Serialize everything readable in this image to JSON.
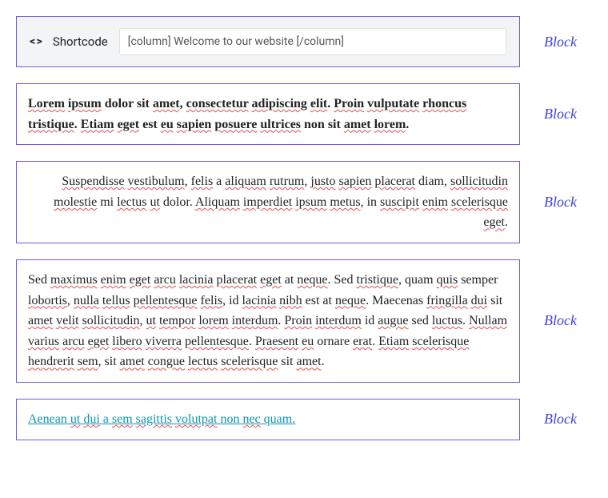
{
  "shortcode": {
    "title": "Shortcode",
    "value": "[column] Welcome to our website [/column]"
  },
  "blocks": {
    "bold_para": "Lorem ipsum dolor sit amet, consectetur adipiscing elit. Proin vulputate rhoncus tristique. Etiam eget est eu sapien posuere ultrices non sit amet lorem.",
    "right_para": "Suspendisse vestibulum, felis a aliquam rutrum, justo sapien placerat diam, sollicitudin molestie mi lectus ut dolor. Aliquam imperdiet ipsum metus, in suscipit enim scelerisque eget.",
    "long_para": "Sed maximus enim eget arcu lacinia placerat eget at neque. Sed tristique, quam quis semper lobortis, nulla tellus pellentesque felis, id lacinia nibh est at neque. Maecenas fringilla dui sit amet velit sollicitudin, ut tempor lorem interdum. Proin interdum id augue sed luctus. Nullam varius arcu eget libero viverra pellentesque. Praesent eu ornare erat. Etiam scelerisque hendrerit sem, sit amet congue lectus scelerisque sit amet.",
    "link_para": "Aenean ut dui a sem sagittis volutpat non nec quam."
  },
  "labels": {
    "block": "Block"
  },
  "spellcheck_words": [
    "Lorem",
    "ipsum",
    "amet",
    "consectetur",
    "adipiscing",
    "elit",
    "Proin",
    "vulputate",
    "rhoncus",
    "tristique",
    "Etiam",
    "eget",
    "eu",
    "sapien",
    "posuere",
    "ultrices",
    "amet",
    "lorem",
    "Suspendisse",
    "vestibulum",
    "felis",
    "aliquam",
    "rutrum",
    "justo",
    "sapien",
    "placerat",
    "sollicitudin",
    "molestie",
    "lectus",
    "ut",
    "Aliquam",
    "imperdiet",
    "ipsum",
    "metus",
    "suscipit",
    "enim",
    "scelerisque",
    "eget",
    "maximus",
    "enim",
    "eget",
    "arcu",
    "lacinia",
    "placerat",
    "eget",
    "neque",
    "tristique",
    "quis",
    "lobortis",
    "nulla",
    "tellus",
    "pellentesque",
    "felis",
    "lacinia",
    "nibh",
    "neque",
    "fringilla",
    "dui",
    "amet",
    "velit",
    "sollicitudin",
    "ut",
    "tempor",
    "lorem",
    "interdum",
    "interdum",
    "augue",
    "luctus",
    "Nullam",
    "varius",
    "arcu",
    "eget",
    "libero",
    "viverra",
    "pellentesque",
    "Praesent",
    "eu",
    "erat",
    "Etiam",
    "scelerisque",
    "hendrerit",
    "sem",
    "amet",
    "congue",
    "lectus",
    "scelerisque",
    "amet",
    "ut",
    "dui",
    "sem",
    "sagittis",
    "volutpat",
    "nec"
  ]
}
